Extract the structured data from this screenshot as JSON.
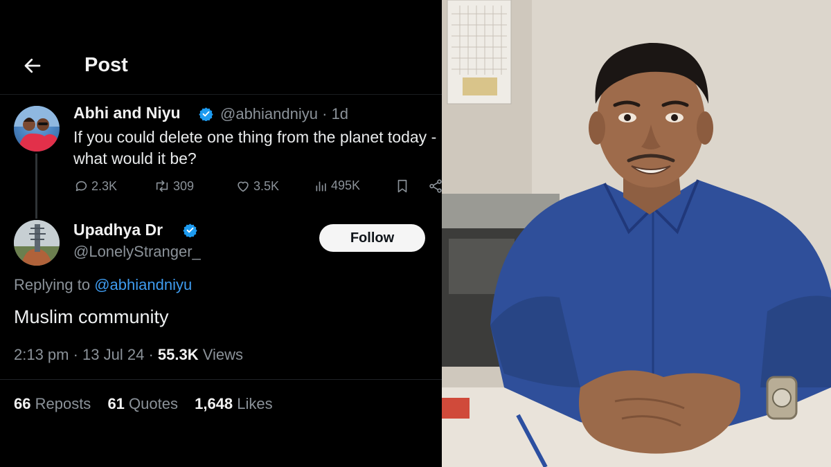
{
  "header": {
    "title": "Post"
  },
  "original_post": {
    "author_name": "Abhi and Niyu",
    "handle": "@abhiandniyu",
    "time_ago": "· 1d",
    "text": "If you could delete one thing from the planet today - what would it be?",
    "replies": "2.3K",
    "reposts": "309",
    "likes": "3.5K",
    "views": "495K"
  },
  "reply_post": {
    "author_name": "Upadhya Dr",
    "handle": "@LonelyStranger_",
    "follow_label": "Follow",
    "replying_prefix": "Replying to",
    "replying_handle": "@abhiandniyu",
    "text": "Muslim community",
    "timestamp": "2:13 pm · 13 Jul 24 · ",
    "views_count": "55.3K",
    "views_label": " Views"
  },
  "stats": {
    "reposts_count": "66",
    "reposts_label": " Reposts",
    "quotes_count": "61",
    "quotes_label": " Quotes",
    "likes_count": "1,648",
    "likes_label": " Likes"
  },
  "colors": {
    "background": "#000000",
    "verified": "#1d9bf0",
    "link": "#3f9cf0",
    "muted": "#8b9299",
    "shirt": "#2f4f9a"
  }
}
